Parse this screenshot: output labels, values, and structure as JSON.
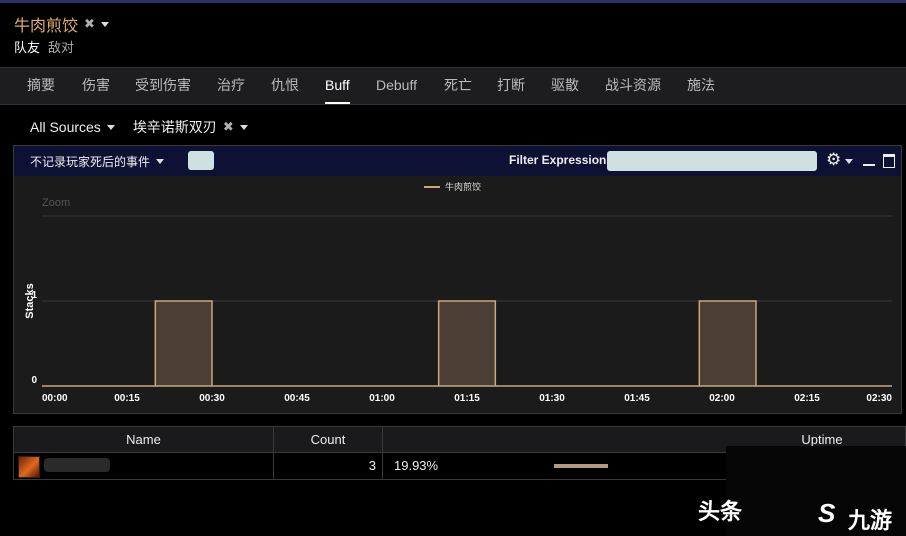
{
  "header": {
    "title": "牛肉煎饺",
    "remove_glyph": "✖",
    "sub_ally": "队友",
    "sub_enemy": "敌对"
  },
  "tabs": [
    {
      "label": "摘要",
      "active": false
    },
    {
      "label": "伤害",
      "active": false
    },
    {
      "label": "受到伤害",
      "active": false
    },
    {
      "label": "治疗",
      "active": false
    },
    {
      "label": "仇恨",
      "active": false
    },
    {
      "label": "Buff",
      "active": true
    },
    {
      "label": "Debuff",
      "active": false
    },
    {
      "label": "死亡",
      "active": false
    },
    {
      "label": "打断",
      "active": false
    },
    {
      "label": "驱散",
      "active": false
    },
    {
      "label": "战斗资源",
      "active": false
    },
    {
      "label": "施法",
      "active": false
    }
  ],
  "filters": {
    "sources": "All Sources",
    "ability": "埃辛诺斯双刃",
    "remove_glyph": "✖"
  },
  "toolbar": {
    "death_filter": "不记录玩家死后的事件",
    "filter_label": "Filter Expression:",
    "filter_value": ""
  },
  "chart_data": {
    "type": "area",
    "legend": [
      "牛肉煎饺"
    ],
    "overlay_text": "Zoom",
    "ylabel": "Stacks",
    "xlabel": "",
    "y_ticks": [
      "0",
      "1"
    ],
    "ylim": [
      0,
      2
    ],
    "x_ticks": [
      "00:00",
      "00:15",
      "00:30",
      "00:45",
      "01:00",
      "01:15",
      "01:30",
      "01:45",
      "02:00",
      "02:15",
      "02:30"
    ],
    "xlim_seconds": [
      0,
      150
    ],
    "series": [
      {
        "name": "牛肉煎饺",
        "color": "#c9a87c",
        "fill": "#4b3f35",
        "intervals": [
          {
            "start": "00:20",
            "end": "00:30",
            "stacks": 1
          },
          {
            "start": "01:10",
            "end": "01:20",
            "stacks": 1
          },
          {
            "start": "01:56",
            "end": "02:06",
            "stacks": 1
          }
        ]
      }
    ]
  },
  "table": {
    "headers": {
      "name": "Name",
      "count": "Count",
      "uptime": "Uptime"
    },
    "rows": [
      {
        "name": "",
        "count": "3",
        "uptime": "19.93%",
        "uptime_fraction": 0.1993
      }
    ]
  },
  "watermark": {
    "text": "头条",
    "logo": "S",
    "brand": "九游"
  }
}
